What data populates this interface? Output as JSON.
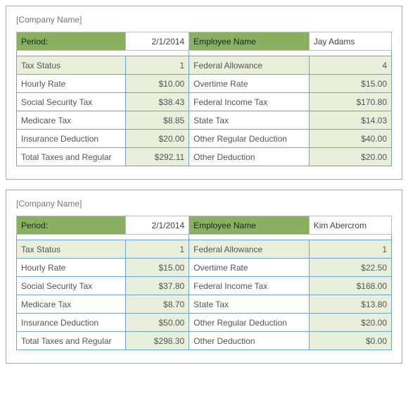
{
  "stubs": [
    {
      "company": "[Company Name]",
      "period_label": "Period:",
      "period_value": "2/1/2014",
      "emp_label": "Employee Name",
      "emp_value": "Jay Adams",
      "rows": [
        {
          "l1": "Tax Status",
          "v1": "1",
          "l2": "Federal Allowance",
          "v2": "4"
        },
        {
          "l1": "Hourly Rate",
          "v1": "$10.00",
          "l2": "Overtime Rate",
          "v2": "$15.00"
        },
        {
          "l1": "Social Security Tax",
          "v1": "$38.43",
          "l2": "Federal Income Tax",
          "v2": "$170.80"
        },
        {
          "l1": "Medicare Tax",
          "v1": "$8.85",
          "l2": "State Tax",
          "v2": "$14.03"
        },
        {
          "l1": "Insurance Deduction",
          "v1": "$20.00",
          "l2": "Other Regular Deduction",
          "v2": "$40.00"
        },
        {
          "l1": "Total Taxes and Regular",
          "v1": "$292.11",
          "l2": "Other Deduction",
          "v2": "$20.00"
        }
      ]
    },
    {
      "company": "[Company Name]",
      "period_label": "Period:",
      "period_value": "2/1/2014",
      "emp_label": "Employee Name",
      "emp_value": "Kim Abercrom",
      "rows": [
        {
          "l1": "Tax Status",
          "v1": "1",
          "l2": "Federal Allowance",
          "v2": "1"
        },
        {
          "l1": "Hourly Rate",
          "v1": "$15.00",
          "l2": "Overtime Rate",
          "v2": "$22.50"
        },
        {
          "l1": "Social Security Tax",
          "v1": "$37.80",
          "l2": "Federal Income Tax",
          "v2": "$168.00"
        },
        {
          "l1": "Medicare Tax",
          "v1": "$8.70",
          "l2": "State Tax",
          "v2": "$13.80"
        },
        {
          "l1": "Insurance Deduction",
          "v1": "$50.00",
          "l2": "Other Regular Deduction",
          "v2": "$20.00"
        },
        {
          "l1": "Total Taxes and Regular",
          "v1": "$298.30",
          "l2": "Other Deduction",
          "v2": "$0.00"
        }
      ]
    }
  ]
}
